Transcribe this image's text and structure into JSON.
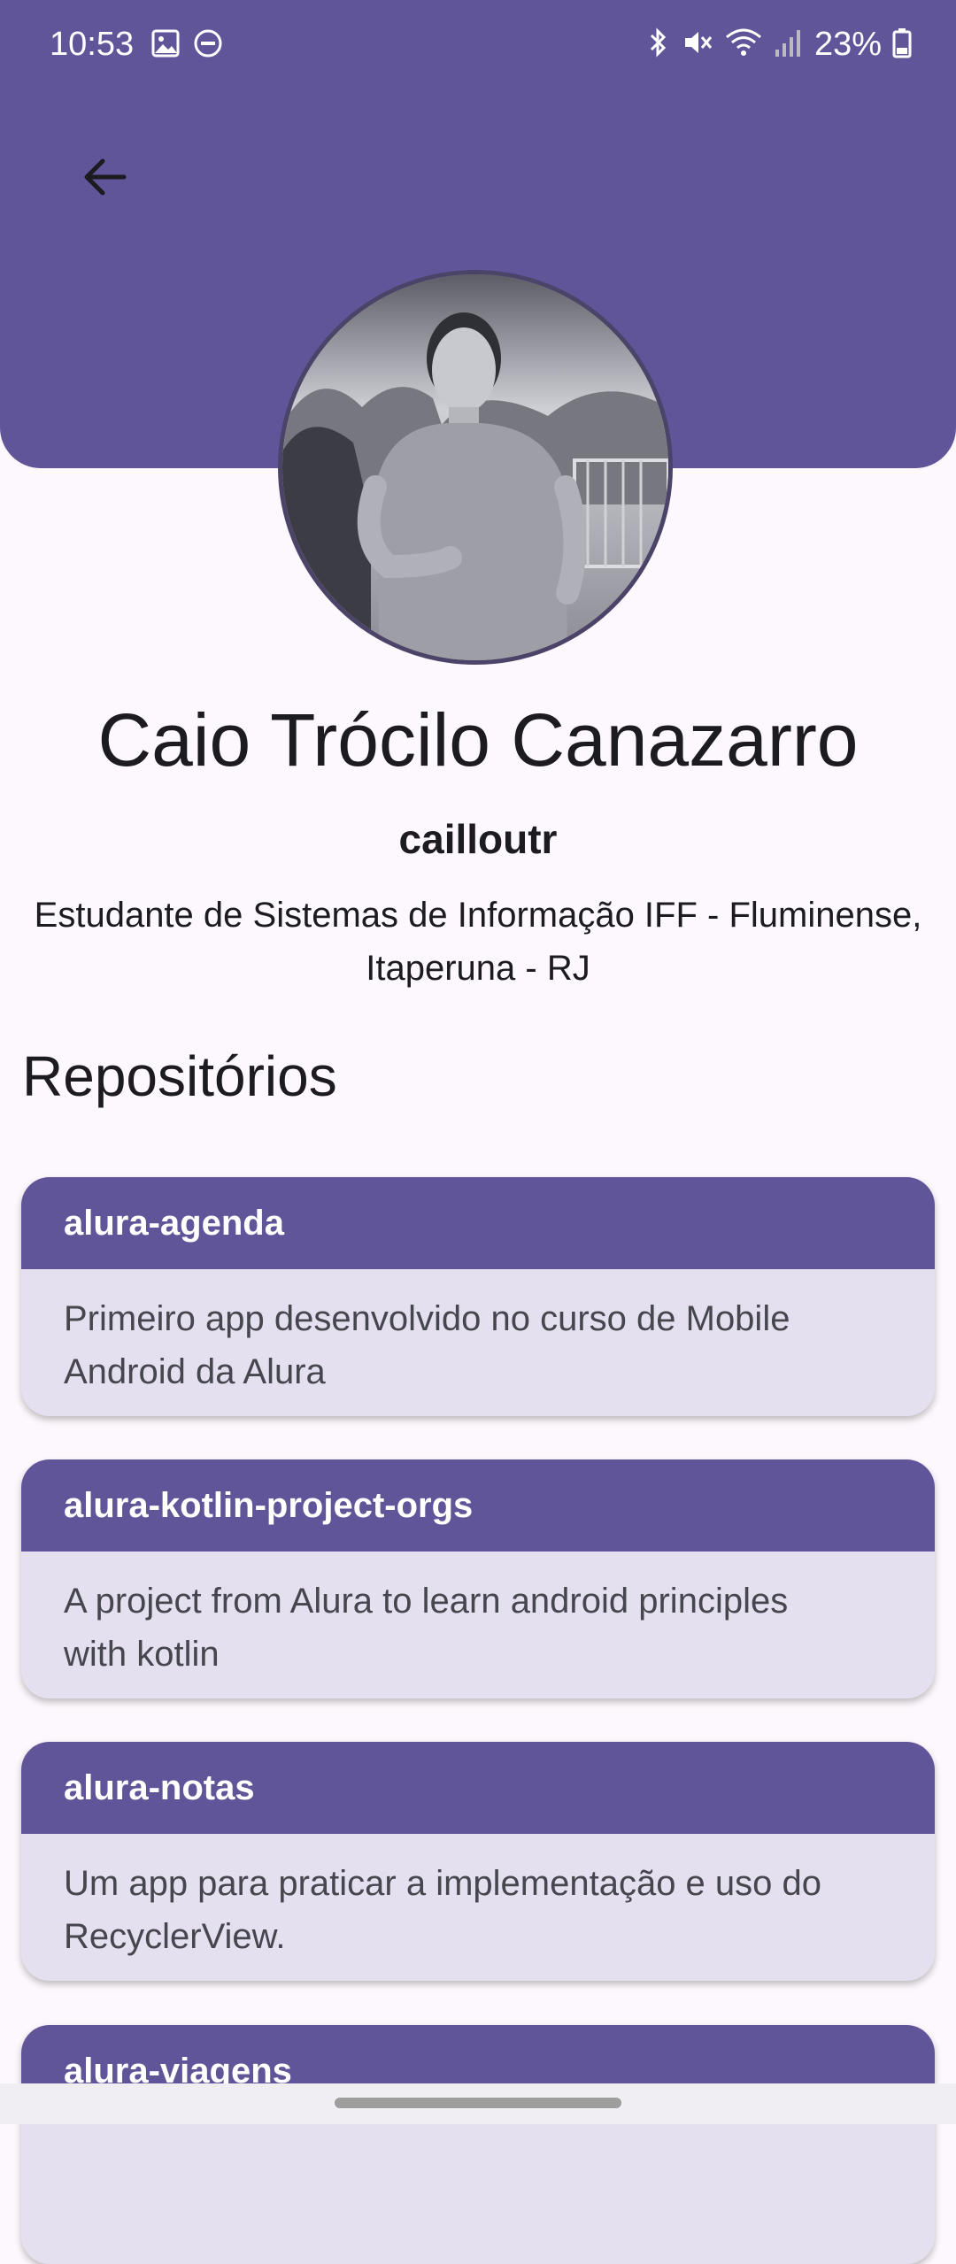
{
  "status_bar": {
    "time": "10:53",
    "battery": "23%",
    "icons": [
      "image-icon",
      "do-not-disturb-icon",
      "bluetooth-icon",
      "mute-icon",
      "wifi-icon",
      "signal-icon",
      "battery-icon"
    ]
  },
  "colors": {
    "primary": "#605599",
    "card_body": "#e5e0ef",
    "background": "#fdf8fd"
  },
  "profile": {
    "name": "Caio Trócilo Canazarro",
    "username": "cailloutr",
    "bio_line1": "Estudante de Sistemas de Informação IFF - Fluminense,",
    "bio_line2": "Itaperuna - RJ"
  },
  "repositories": {
    "title": "Repositórios",
    "items": [
      {
        "name": "alura-agenda",
        "description_line1": "Primeiro app desenvolvido no curso de Mobile",
        "description_line2": "Android da Alura"
      },
      {
        "name": "alura-kotlin-project-orgs",
        "description_line1": "A project from Alura to learn android principles",
        "description_line2": "with kotlin"
      },
      {
        "name": "alura-notas",
        "description_line1": "Um app para praticar a implementação e uso do",
        "description_line2": "RecyclerView."
      },
      {
        "name": "alura-viagens",
        "description_line1": "",
        "description_line2": ""
      }
    ]
  }
}
